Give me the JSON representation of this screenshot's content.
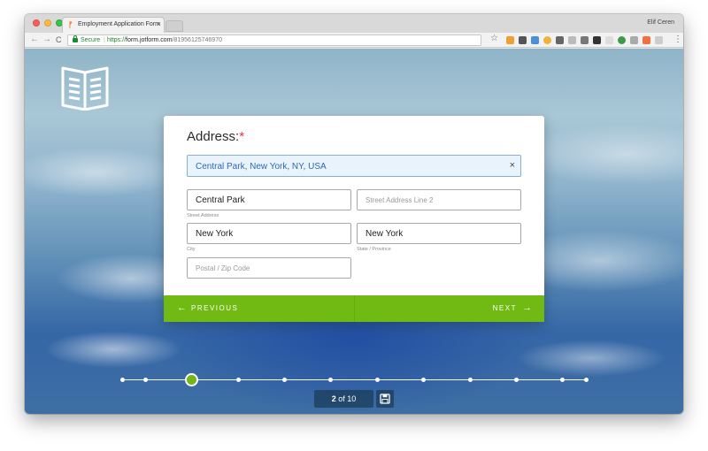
{
  "browser": {
    "tab_title": "Employment Application Form",
    "tab_close": "×",
    "user_name": "Elif Ceren",
    "secure_label": "Secure",
    "url_scheme": "https://",
    "url_host": "form.jotform.com",
    "url_path": "/81956125746970",
    "star": "☆",
    "menu": "⋮",
    "nav_back": "←",
    "nav_forward": "→",
    "nav_reload": "C"
  },
  "form": {
    "question_label": "Address:",
    "required_mark": "*",
    "lookup_value": "Central Park, New York, NY, USA",
    "lookup_clear": "×",
    "street1": {
      "value": "Central Park",
      "sublabel": "Street Address"
    },
    "street2": {
      "placeholder": "Street Address Line 2"
    },
    "city": {
      "value": "New York",
      "sublabel": "City"
    },
    "state": {
      "value": "New York",
      "sublabel": "State / Province"
    },
    "postal": {
      "placeholder": "Postal / Zip Code"
    }
  },
  "buttons": {
    "previous_label": "PREVIOUS",
    "previous_arrow": "←",
    "next_label": "NEXT",
    "next_arrow": "→",
    "accent": "#71b913"
  },
  "progress": {
    "current_step": "2",
    "total_text": "of 10",
    "current_step_index": 2,
    "total_steps": 10
  }
}
